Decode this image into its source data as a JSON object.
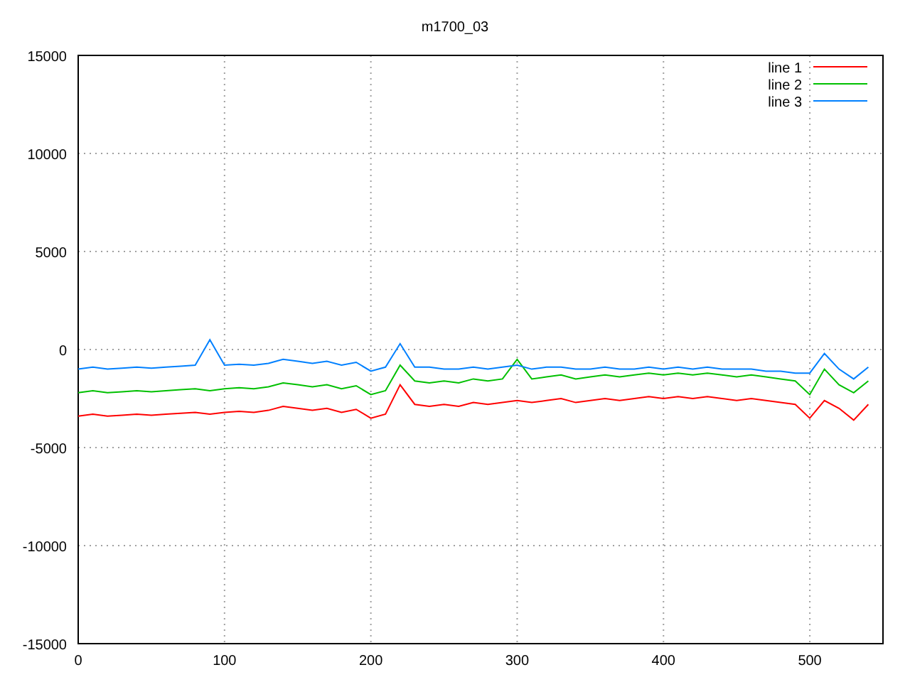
{
  "chart_data": {
    "type": "line",
    "title": "m1700_03",
    "x": [
      0,
      10,
      20,
      30,
      40,
      50,
      60,
      70,
      80,
      90,
      100,
      110,
      120,
      130,
      140,
      150,
      160,
      170,
      180,
      190,
      200,
      210,
      220,
      230,
      240,
      250,
      260,
      270,
      280,
      290,
      300,
      310,
      320,
      330,
      340,
      350,
      360,
      370,
      380,
      390,
      400,
      410,
      420,
      430,
      440,
      450,
      460,
      470,
      480,
      490,
      500,
      510,
      520,
      530,
      540
    ],
    "series": [
      {
        "name": "line 1",
        "color": "#ff0000",
        "values": [
          -3400,
          -3300,
          -3400,
          -3350,
          -3300,
          -3350,
          -3300,
          -3250,
          -3200,
          -3300,
          -3200,
          -3150,
          -3200,
          -3100,
          -2900,
          -3000,
          -3100,
          -3000,
          -3200,
          -3050,
          -3500,
          -3300,
          -1800,
          -2800,
          -2900,
          -2800,
          -2900,
          -2700,
          -2800,
          -2700,
          -2600,
          -2700,
          -2600,
          -2500,
          -2700,
          -2600,
          -2500,
          -2600,
          -2500,
          -2400,
          -2500,
          -2400,
          -2500,
          -2400,
          -2500,
          -2600,
          -2500,
          -2600,
          -2700,
          -2800,
          -3500,
          -2600,
          -3000,
          -3600,
          -2800
        ]
      },
      {
        "name": "line 2",
        "color": "#00c000",
        "values": [
          -2200,
          -2100,
          -2200,
          -2150,
          -2100,
          -2150,
          -2100,
          -2050,
          -2000,
          -2100,
          -2000,
          -1950,
          -2000,
          -1900,
          -1700,
          -1800,
          -1900,
          -1800,
          -2000,
          -1850,
          -2300,
          -2100,
          -800,
          -1600,
          -1700,
          -1600,
          -1700,
          -1500,
          -1600,
          -1500,
          -500,
          -1500,
          -1400,
          -1300,
          -1500,
          -1400,
          -1300,
          -1400,
          -1300,
          -1200,
          -1300,
          -1200,
          -1300,
          -1200,
          -1300,
          -1400,
          -1300,
          -1400,
          -1500,
          -1600,
          -2300,
          -1000,
          -1800,
          -2200,
          -1600
        ]
      },
      {
        "name": "line 3",
        "color": "#0080ff",
        "values": [
          -1000,
          -900,
          -1000,
          -950,
          -900,
          -950,
          -900,
          -850,
          -800,
          500,
          -800,
          -750,
          -800,
          -700,
          -500,
          -600,
          -700,
          -600,
          -800,
          -650,
          -1100,
          -900,
          300,
          -900,
          -900,
          -1000,
          -1000,
          -900,
          -1000,
          -900,
          -800,
          -1000,
          -900,
          -900,
          -1000,
          -1000,
          -900,
          -1000,
          -1000,
          -900,
          -1000,
          -900,
          -1000,
          -900,
          -1000,
          -1000,
          -1000,
          -1100,
          -1100,
          -1200,
          -1200,
          -200,
          -1000,
          -1500,
          -900
        ]
      }
    ],
    "grid": true,
    "legend": true,
    "xlim": [
      0,
      550
    ],
    "ylim": [
      -15000,
      15000
    ],
    "xticks": [
      0,
      100,
      200,
      300,
      400,
      500
    ],
    "yticks": [
      -15000,
      -10000,
      -5000,
      0,
      5000,
      10000,
      15000
    ]
  }
}
